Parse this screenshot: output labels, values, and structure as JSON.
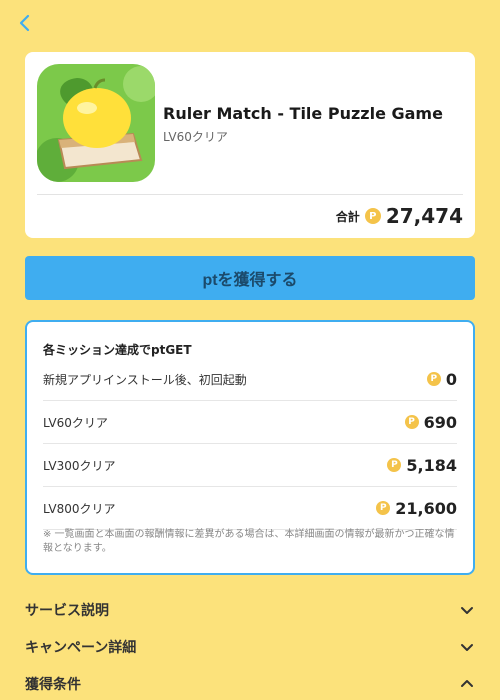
{
  "header": {
    "back_icon": "chevron-left-icon"
  },
  "app": {
    "title": "Ruler Match - Tile Puzzle Game",
    "subtitle": "LV60クリア",
    "total_label": "合計",
    "total_value": "27,474"
  },
  "cta": {
    "label": "ptを獲得する"
  },
  "missions": {
    "heading": "各ミッション達成でptGET",
    "items": [
      {
        "label": "新規アプリインストール後、初回起動",
        "points": "0"
      },
      {
        "label": "LV60クリア",
        "points": "690"
      },
      {
        "label": "LV300クリア",
        "points": "5,184"
      },
      {
        "label": "LV800クリア",
        "points": "21,600"
      }
    ],
    "note": "※ 一覧画面と本画面の報酬情報に差異がある場合は、本詳細画面の情報が最新かつ正確な情報となります。"
  },
  "coin_glyph": "P",
  "accordions": [
    {
      "label": "サービス説明",
      "state": "collapsed"
    },
    {
      "label": "キャンペーン詳細",
      "state": "collapsed"
    },
    {
      "label": "獲得条件",
      "state": "expanded"
    }
  ],
  "colors": {
    "background": "#FCE27B",
    "accent": "#3FADF0",
    "coin": "#F4C34A"
  }
}
